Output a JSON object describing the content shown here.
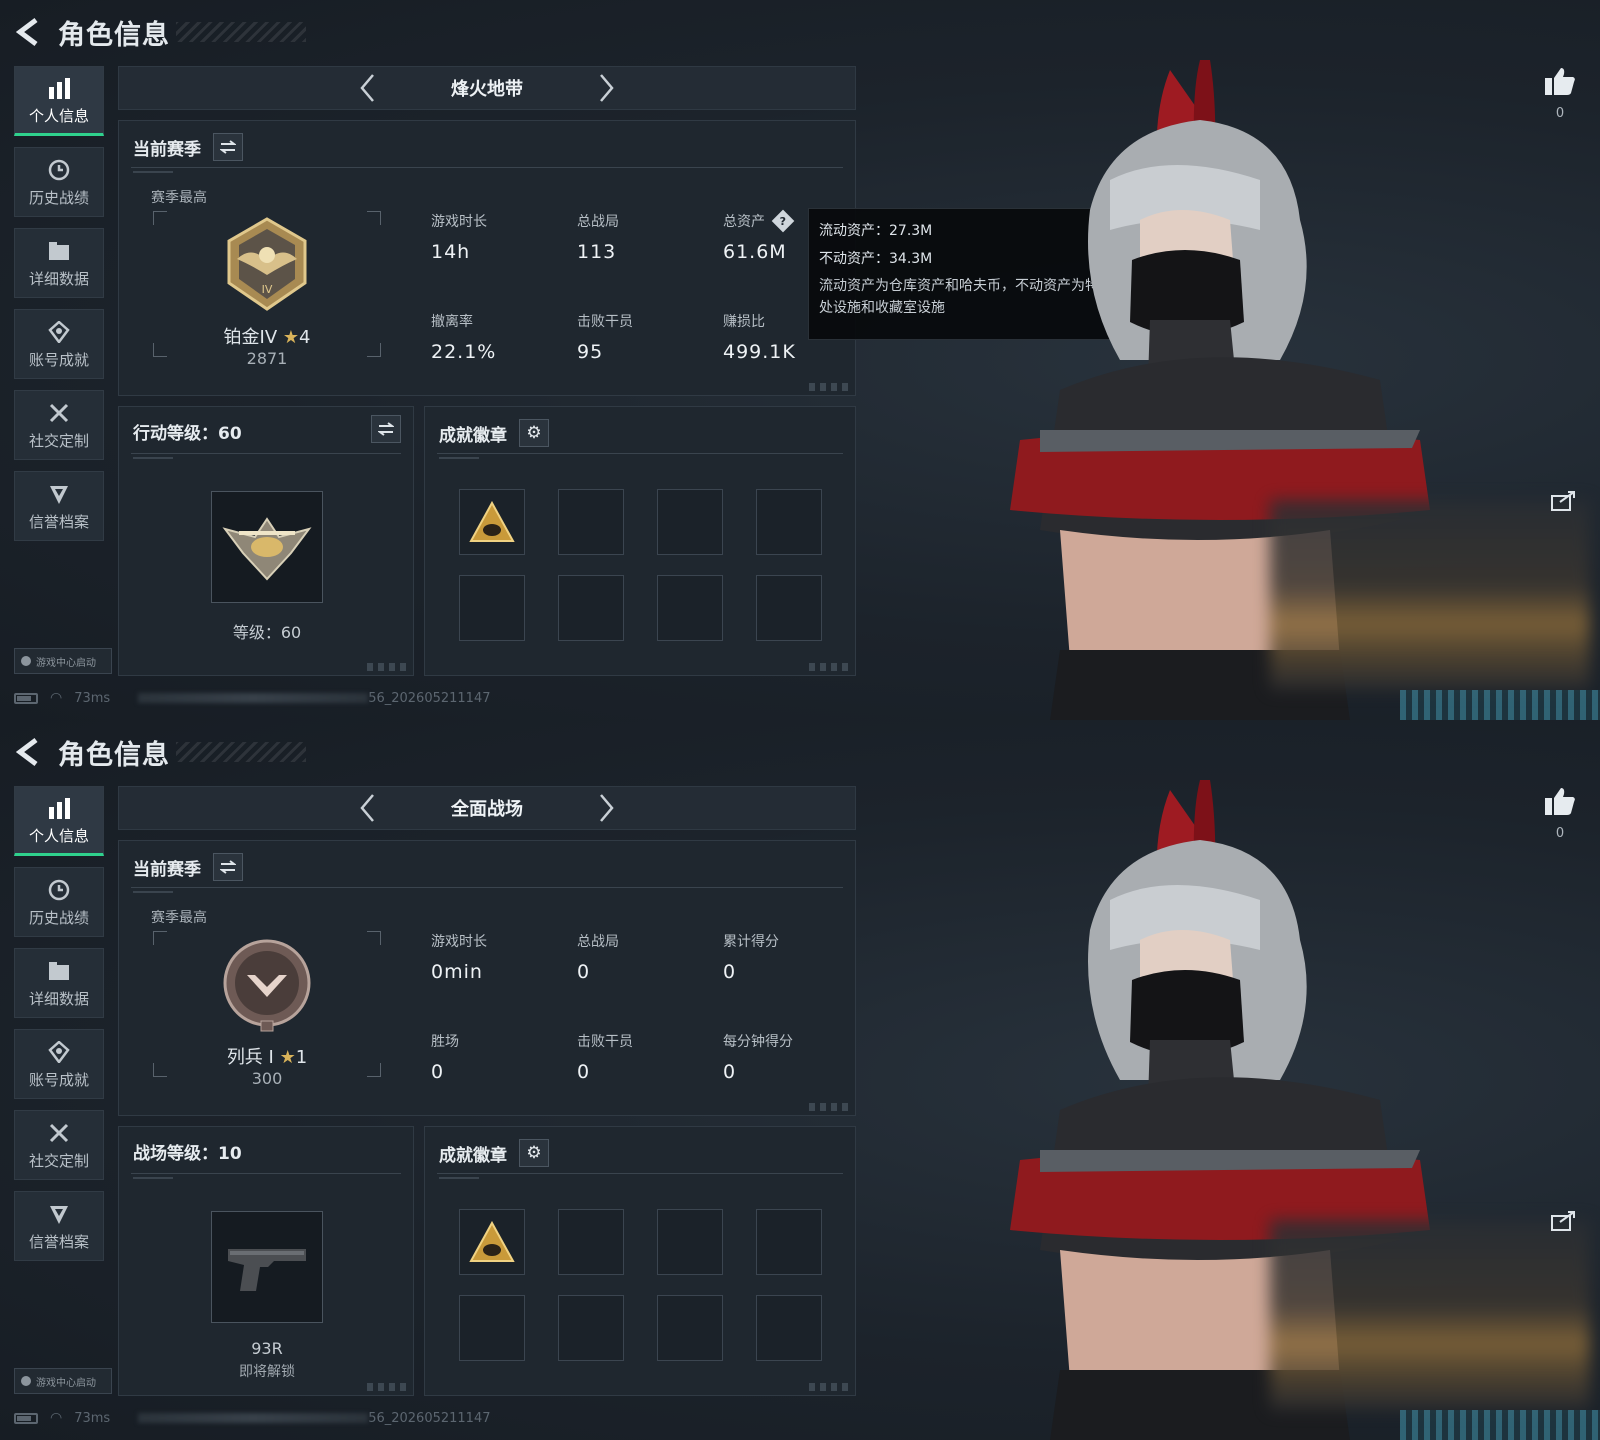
{
  "screens": [
    {
      "header": {
        "title": "角色信息"
      },
      "sidenav": [
        {
          "label": "个人信息",
          "active": true
        },
        {
          "label": "历史战绩"
        },
        {
          "label": "详细数据"
        },
        {
          "label": "账号成就"
        },
        {
          "label": "社交定制"
        },
        {
          "label": "信誉档案"
        }
      ],
      "game_center": "游戏中心启动",
      "footer": {
        "ping": "73ms",
        "id_suffix": "56_202605211147"
      },
      "mode": "烽火地带",
      "season": {
        "title": "当前赛季",
        "sub": "赛季最高",
        "rank": "铂金IV",
        "stars": "4",
        "points": "2871",
        "stats": [
          {
            "label": "游戏时长",
            "value": "14h"
          },
          {
            "label": "总战局",
            "value": "113"
          },
          {
            "label": "总资产",
            "value": "61.6M",
            "help": true
          },
          {
            "label": "撤离率",
            "value": "22.1%"
          },
          {
            "label": "击败干员",
            "value": "95"
          },
          {
            "label": "赚损比",
            "value": "499.1K"
          }
        ]
      },
      "tooltip": {
        "line1": "流动资产：27.3M",
        "line2": "不动资产：34.3M",
        "desc": "流动资产为仓库资产和哈夫币，不动资产为特勤处设施和收藏室设施"
      },
      "level": {
        "title": "行动等级：60",
        "caption": "等级：60",
        "sub": ""
      },
      "badges": {
        "title": "成就徽章"
      },
      "likes": "0"
    },
    {
      "header": {
        "title": "角色信息"
      },
      "sidenav": [
        {
          "label": "个人信息",
          "active": true
        },
        {
          "label": "历史战绩"
        },
        {
          "label": "详细数据"
        },
        {
          "label": "账号成就"
        },
        {
          "label": "社交定制"
        },
        {
          "label": "信誉档案"
        }
      ],
      "game_center": "游戏中心启动",
      "footer": {
        "ping": "73ms",
        "id_suffix": "56_202605211147"
      },
      "mode": "全面战场",
      "season": {
        "title": "当前赛季",
        "sub": "赛季最高",
        "rank": "列兵 I",
        "stars": "1",
        "points": "300",
        "stats": [
          {
            "label": "游戏时长",
            "value": "0min"
          },
          {
            "label": "总战局",
            "value": "0"
          },
          {
            "label": "累计得分",
            "value": "0"
          },
          {
            "label": "胜场",
            "value": "0"
          },
          {
            "label": "击败干员",
            "value": "0"
          },
          {
            "label": "每分钟得分",
            "value": "0"
          }
        ]
      },
      "level": {
        "title": "战场等级：10",
        "caption": "93R",
        "sub": "即将解锁"
      },
      "badges": {
        "title": "成就徽章"
      },
      "likes": "0"
    }
  ]
}
